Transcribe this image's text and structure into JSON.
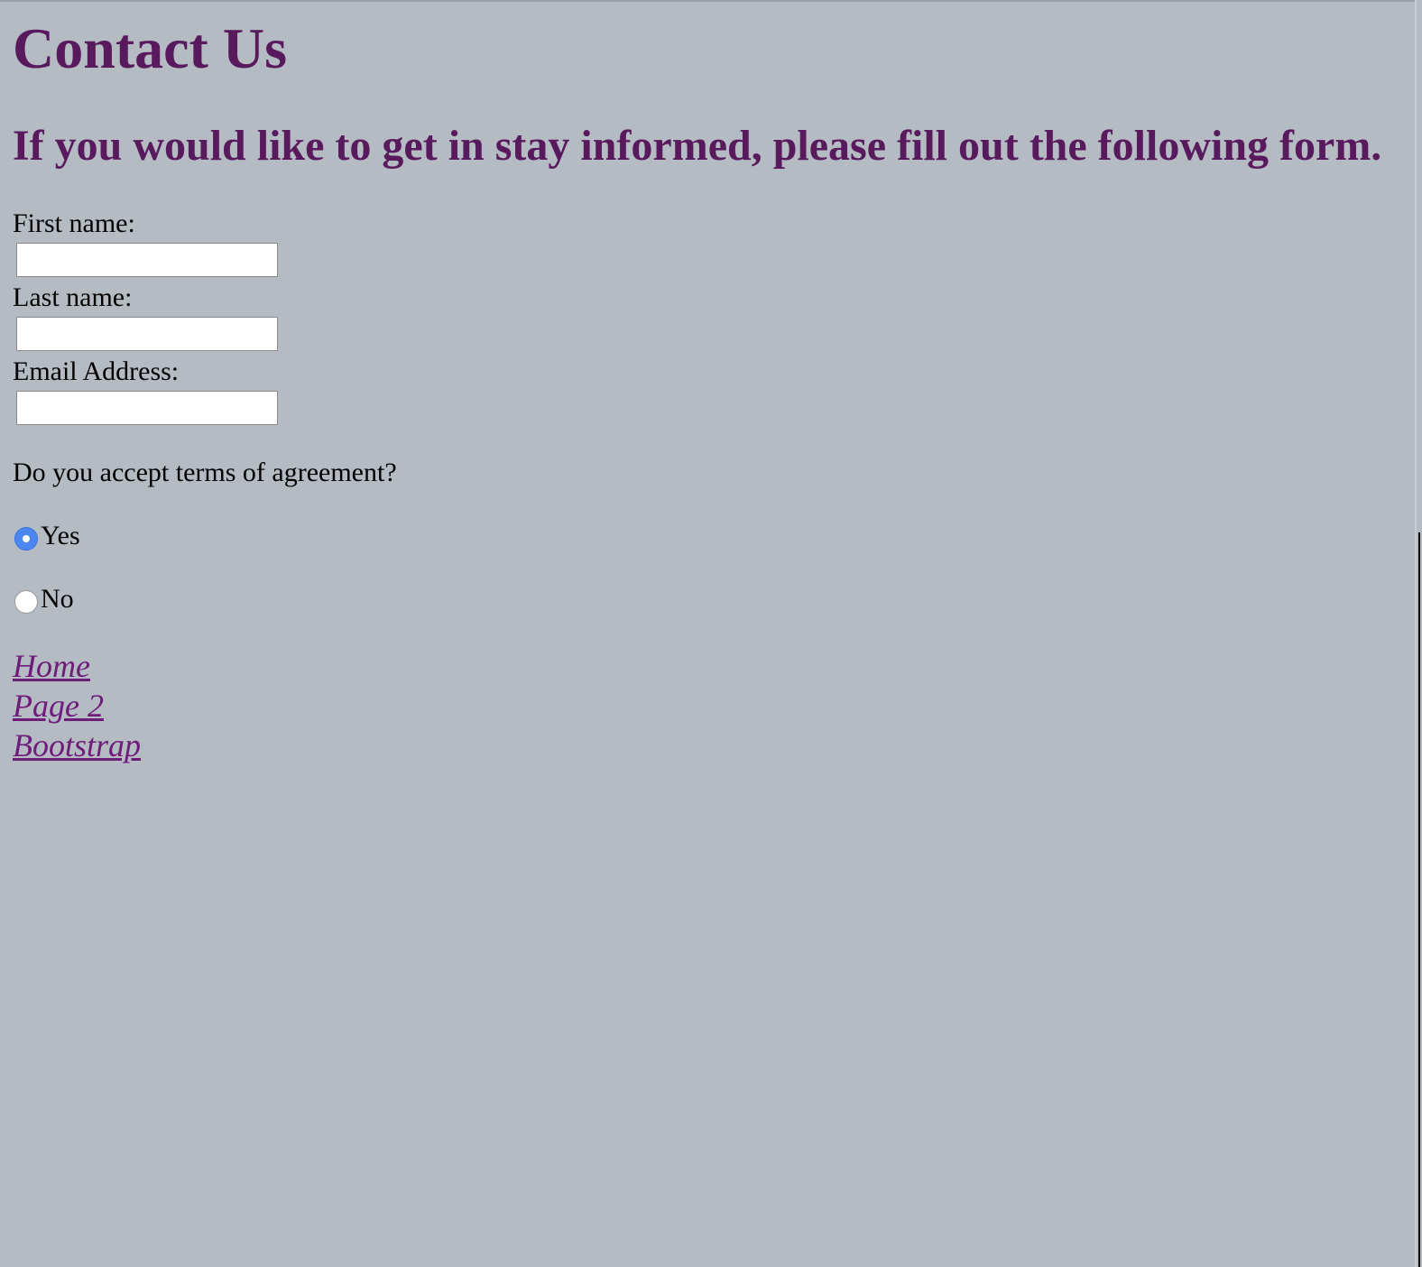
{
  "page": {
    "title": "Contact Us",
    "subtitle": "If you would like to get in stay informed, please fill out the following form."
  },
  "form": {
    "first_name": {
      "label": "First name:",
      "value": ""
    },
    "last_name": {
      "label": "Last name:",
      "value": ""
    },
    "email": {
      "label": "Email Address:",
      "value": ""
    },
    "terms": {
      "question": "Do you accept terms of agreement?",
      "options": [
        {
          "label": "Yes",
          "checked": true
        },
        {
          "label": "No",
          "checked": false
        }
      ]
    }
  },
  "nav": {
    "links": [
      {
        "label": "Home"
      },
      {
        "label": "Page 2"
      },
      {
        "label": "Bootstrap"
      }
    ]
  },
  "colors": {
    "background": "#b4bbc3",
    "heading": "#581a5c",
    "link": "#6e1b7a",
    "radio_checked": "#4c86f0"
  }
}
